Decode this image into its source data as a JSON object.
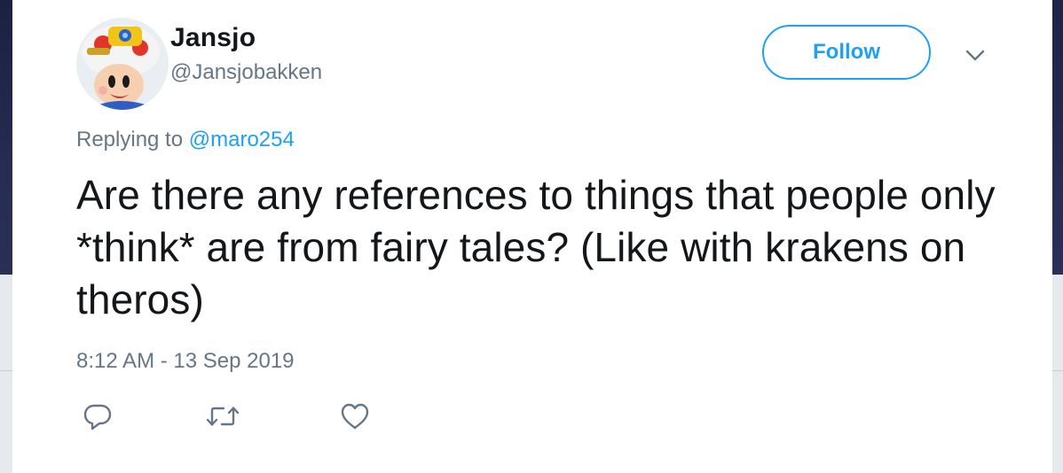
{
  "tweet": {
    "author": {
      "display_name": "Jansjo",
      "handle": "@Jansjobakken",
      "avatar_icon": "toad-avatar-icon"
    },
    "follow_label": "Follow",
    "menu_icon": "chevron-down-icon",
    "reply": {
      "prefix": "Replying to",
      "mention": "@maro254"
    },
    "text": "Are there any references to things that people only *think* are from fairy tales? (Like with krakens on theros)",
    "timestamp": "8:12 AM - 13 Sep 2019",
    "actions": [
      {
        "name": "reply",
        "icon": "reply-icon"
      },
      {
        "name": "retweet",
        "icon": "retweet-icon"
      },
      {
        "name": "like",
        "icon": "heart-icon"
      }
    ]
  },
  "colors": {
    "accent": "#1da1f2",
    "text_primary": "#14171a",
    "text_secondary": "#657786",
    "icon_gray": "#657786"
  }
}
